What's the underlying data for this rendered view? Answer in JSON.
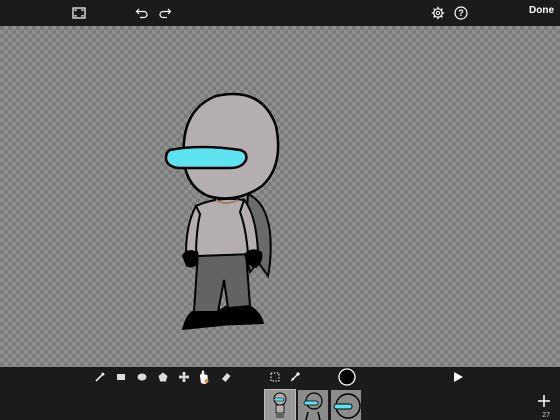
{
  "topbar": {
    "done_label": "Done",
    "icons": [
      "fullscreen-icon",
      "undo-icon",
      "redo-icon",
      "settings-icon",
      "help-icon"
    ]
  },
  "toolbar": {
    "tools": [
      "brush-icon",
      "rectangle-icon",
      "ellipse-icon",
      "polygon-icon",
      "stamp-icon",
      "fill-hand-icon",
      "eraser-icon",
      "select-icon",
      "eyedropper-icon"
    ],
    "current_color": "#000000"
  },
  "filmstrip": {
    "frame_count": "27",
    "frames": [
      "frame-1",
      "frame-2",
      "frame-3"
    ]
  },
  "colors": {
    "visor": "#5de2f0",
    "body": "#b4aeb0",
    "pants": "#636363",
    "outline": "#000000"
  }
}
